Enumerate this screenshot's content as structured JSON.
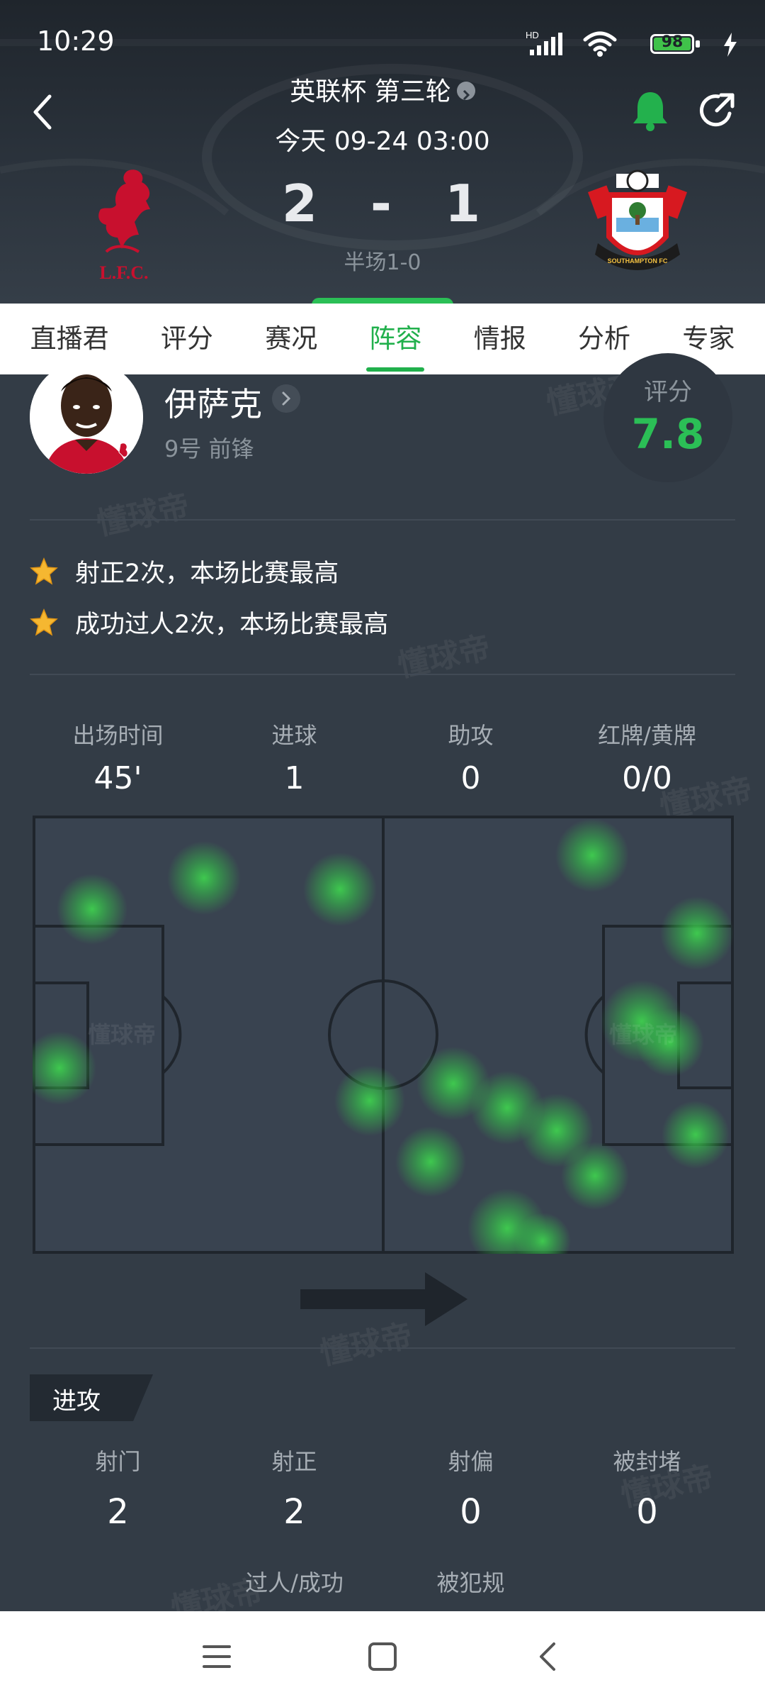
{
  "status_bar": {
    "time": "10:29",
    "battery": "98",
    "network_label": "HD"
  },
  "header": {
    "competition": "英联杯 第三轮",
    "datetime": "今天 09-24 03:00",
    "home_score": "2",
    "separator": "-",
    "away_score": "1",
    "half_time": "半场1-0",
    "home_team_logo_text": "L.F.C.",
    "away_team_logo_text": "SOUTHAMPTON FC"
  },
  "tabs": [
    {
      "label": "直播君"
    },
    {
      "label": "评分"
    },
    {
      "label": "赛况"
    },
    {
      "label": "阵容",
      "active": true
    },
    {
      "label": "情报"
    },
    {
      "label": "分析"
    },
    {
      "label": "专家"
    }
  ],
  "player": {
    "name": "伊萨克",
    "info": "9号 前锋",
    "rating_label": "评分",
    "rating": "7.8"
  },
  "highlights": [
    "射正2次，本场比赛最高",
    "成功过人2次，本场比赛最高"
  ],
  "summary_stats": [
    {
      "label": "出场时间",
      "value": "45'"
    },
    {
      "label": "进球",
      "value": "1"
    },
    {
      "label": "助攻",
      "value": "0"
    },
    {
      "label": "红牌/黄牌",
      "value": "0/0"
    }
  ],
  "heatmap": {
    "watermark": "懂球帝"
  },
  "attack_section": {
    "title": "进攻",
    "stats": [
      {
        "label": "射门",
        "value": "2"
      },
      {
        "label": "射正",
        "value": "2"
      },
      {
        "label": "射偏",
        "value": "0"
      },
      {
        "label": "被封堵",
        "value": "0"
      }
    ],
    "next_labels": [
      "过人/成功",
      "被犯规"
    ]
  },
  "watermark_text": "懂球帝",
  "colors": {
    "accent_green": "#21b04c",
    "rating_green": "#2bbf56",
    "background": "#333c46",
    "home_red": "#c8102e"
  }
}
